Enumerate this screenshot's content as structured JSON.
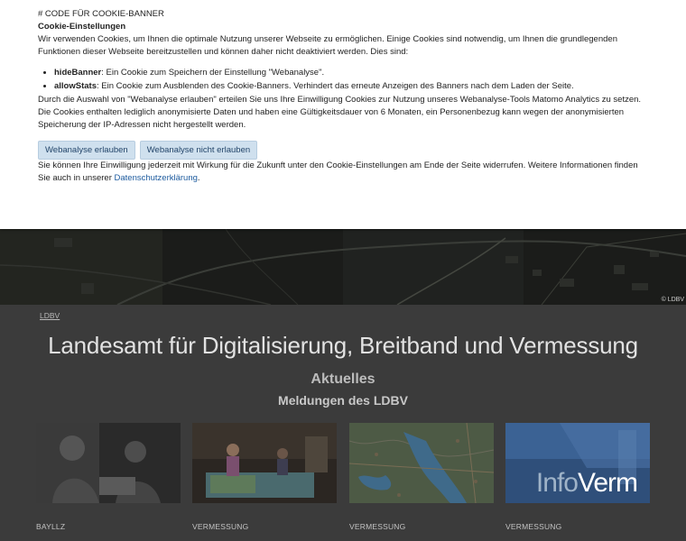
{
  "cookie": {
    "marker": "# CODE FÜR COOKIE-BANNER",
    "heading": "Cookie-Einstellungen",
    "intro": "Wir verwenden Cookies, um Ihnen die optimale Nutzung unserer Webseite zu ermöglichen. Einige Cookies sind notwendig, um Ihnen die grundlegenden Funktionen dieser Webseite bereitzustellen und können daher nicht deaktiviert werden. Dies sind:",
    "items": [
      {
        "name": "hideBanner",
        "text": ": Ein Cookie zum Speichern der Einstellung \"Webanalyse\"."
      },
      {
        "name": "allowStats",
        "text": ": Ein Cookie zum Ausblenden des Cookie-Banners. Verhindert das erneute Anzeigen des Banners nach dem Laden der Seite."
      }
    ],
    "analysis_text": "Durch die Auswahl von \"Webanalyse erlauben\" erteilen Sie uns Ihre Einwilligung Cookies zur Nutzung unseres Webanalyse-Tools Matomo Analytics zu setzen. Die Cookies enthalten lediglich anonymisierte Daten und haben eine Gültigkeitsdauer von 6 Monaten, ein Personenbezug kann wegen der anonymisierten Speicherung der IP-Adressen nicht hergestellt werden.",
    "allow_label": "Webanalyse erlauben",
    "deny_label": "Webanalyse nicht erlauben",
    "revoke_text": "Sie können Ihre Einwilligung jederzeit mit Wirkung für die Zukunft unter den Cookie-Einstellungen am Ende der Seite widerrufen. Weitere Informationen finden Sie auch in unserer ",
    "privacy_link": "Datenschutzerklärung",
    "revoke_end": "."
  },
  "hero": {
    "credit": "© LDBV"
  },
  "page": {
    "breadcrumb": "LDBV",
    "title": "Landesamt für Digitalisierung, Breitband und Vermessung",
    "section_title": "Aktuelles",
    "section_subtitle": "Meldungen des LDBV"
  },
  "cards": [
    {
      "category": "BAYLLZ"
    },
    {
      "category": "VERMESSUNG"
    },
    {
      "category": "VERMESSUNG"
    },
    {
      "category": "VERMESSUNG",
      "image_text_a": "Info",
      "image_text_b": "Verm"
    }
  ],
  "colors": {
    "banner_bg": "#ffffff",
    "button_bg": "#cfe0ee",
    "link": "#1c5a9e",
    "overlay_bg": "#3b3b3b"
  }
}
